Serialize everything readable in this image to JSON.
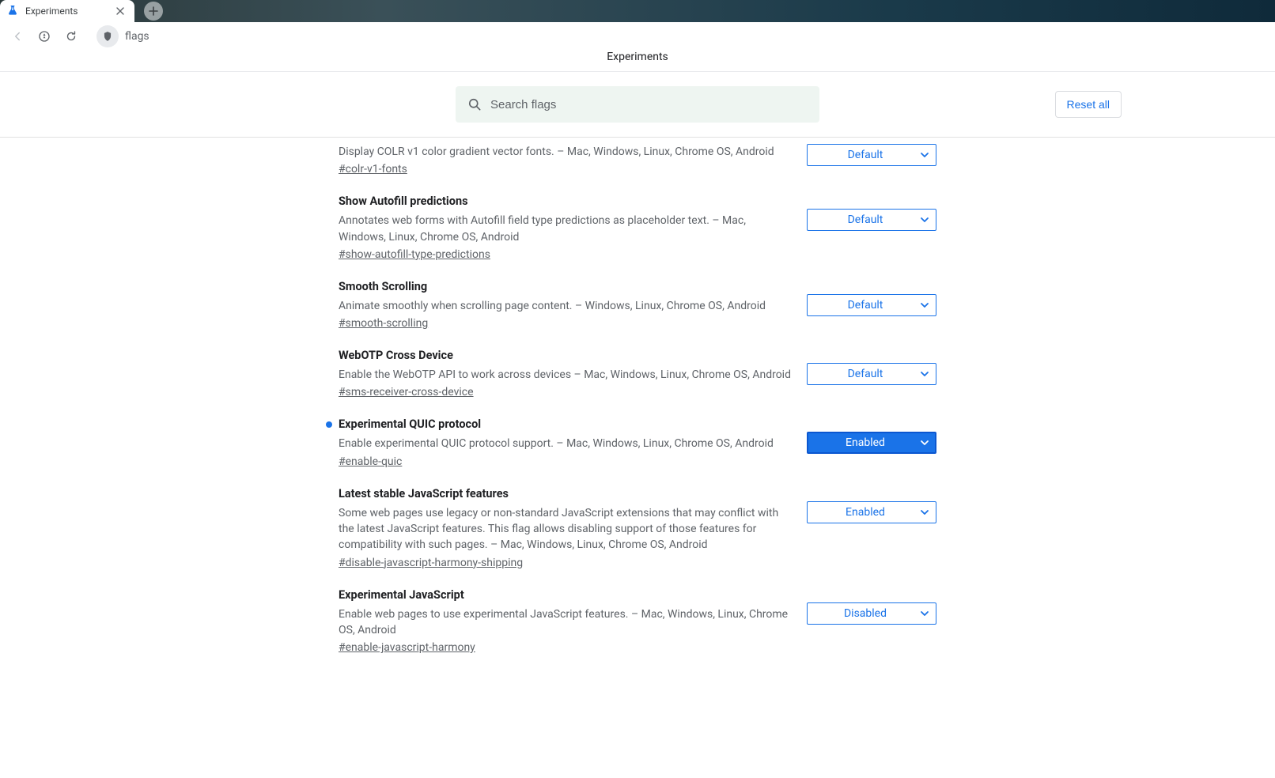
{
  "tab": {
    "title": "Experiments"
  },
  "url": "flags",
  "page_title": "Experiments",
  "search": {
    "placeholder": "Search flags"
  },
  "reset_label": "Reset all",
  "flags": [
    {
      "title": "",
      "desc": "Display COLR v1 color gradient vector fonts. – Mac, Windows, Linux, Chrome OS, Android",
      "link": "#colr-v1-fonts",
      "value": "Default",
      "active": false,
      "modified": false
    },
    {
      "title": "Show Autofill predictions",
      "desc": "Annotates web forms with Autofill field type predictions as placeholder text. – Mac, Windows, Linux, Chrome OS, Android",
      "link": "#show-autofill-type-predictions",
      "value": "Default",
      "active": false,
      "modified": false
    },
    {
      "title": "Smooth Scrolling",
      "desc": "Animate smoothly when scrolling page content. – Windows, Linux, Chrome OS, Android",
      "link": "#smooth-scrolling",
      "value": "Default",
      "active": false,
      "modified": false
    },
    {
      "title": "WebOTP Cross Device",
      "desc": "Enable the WebOTP API to work across devices – Mac, Windows, Linux, Chrome OS, Android",
      "link": "#sms-receiver-cross-device",
      "value": "Default",
      "active": false,
      "modified": false
    },
    {
      "title": "Experimental QUIC protocol",
      "desc": "Enable experimental QUIC protocol support. – Mac, Windows, Linux, Chrome OS, Android",
      "link": "#enable-quic",
      "value": "Enabled",
      "active": true,
      "modified": true
    },
    {
      "title": "Latest stable JavaScript features",
      "desc": "Some web pages use legacy or non-standard JavaScript extensions that may conflict with the latest JavaScript features. This flag allows disabling support of those features for compatibility with such pages. – Mac, Windows, Linux, Chrome OS, Android",
      "link": "#disable-javascript-harmony-shipping",
      "value": "Enabled",
      "active": false,
      "modified": false
    },
    {
      "title": "Experimental JavaScript",
      "desc": "Enable web pages to use experimental JavaScript features. – Mac, Windows, Linux, Chrome OS, Android",
      "link": "#enable-javascript-harmony",
      "value": "Disabled",
      "active": false,
      "modified": false
    }
  ]
}
